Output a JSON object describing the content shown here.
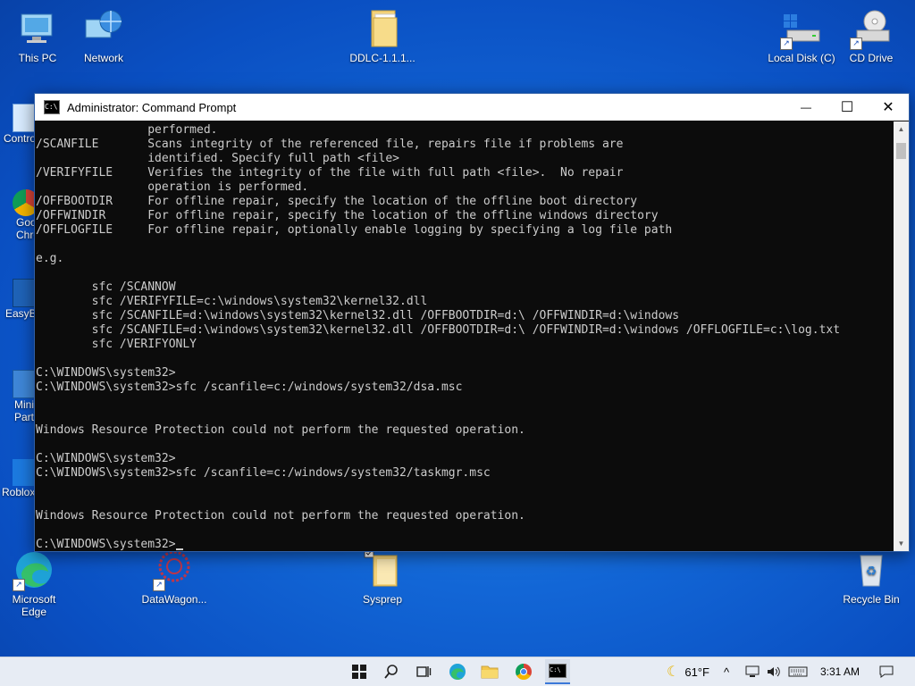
{
  "desktop": {
    "icons_top": [
      {
        "label": "This PC"
      },
      {
        "label": "Network"
      },
      {
        "label": "DDLC-1.1.1..."
      },
      {
        "label": "Local Disk (C)"
      },
      {
        "label": "CD Drive"
      }
    ],
    "icons_left_partial": [
      {
        "label": "Contro"
      },
      {
        "label": "Goo\nChro"
      },
      {
        "label": "EasyBo"
      },
      {
        "label": "Mini\nPart"
      },
      {
        "label": "Roblox"
      }
    ],
    "icons_bottom": [
      {
        "label": "Microsoft\nEdge"
      },
      {
        "label": "DataWagon..."
      },
      {
        "label": "Sysprep"
      },
      {
        "label": "Recycle Bin"
      }
    ]
  },
  "window": {
    "title": "Administrator: Command Prompt",
    "icon_text": "C:\\",
    "minimize": "—",
    "maximize": "☐",
    "close": "✕"
  },
  "console": {
    "lines": [
      "                performed.",
      "/SCANFILE       Scans integrity of the referenced file, repairs file if problems are",
      "                identified. Specify full path <file>",
      "/VERIFYFILE     Verifies the integrity of the file with full path <file>.  No repair",
      "                operation is performed.",
      "/OFFBOOTDIR     For offline repair, specify the location of the offline boot directory",
      "/OFFWINDIR      For offline repair, specify the location of the offline windows directory",
      "/OFFLOGFILE     For offline repair, optionally enable logging by specifying a log file path",
      "",
      "e.g.",
      "",
      "        sfc /SCANNOW",
      "        sfc /VERIFYFILE=c:\\windows\\system32\\kernel32.dll",
      "        sfc /SCANFILE=d:\\windows\\system32\\kernel32.dll /OFFBOOTDIR=d:\\ /OFFWINDIR=d:\\windows",
      "        sfc /SCANFILE=d:\\windows\\system32\\kernel32.dll /OFFBOOTDIR=d:\\ /OFFWINDIR=d:\\windows /OFFLOGFILE=c:\\log.txt",
      "        sfc /VERIFYONLY",
      "",
      "C:\\WINDOWS\\system32>",
      "C:\\WINDOWS\\system32>sfc /scanfile=c:/windows/system32/dsa.msc",
      "",
      "",
      "Windows Resource Protection could not perform the requested operation.",
      "",
      "C:\\WINDOWS\\system32>",
      "C:\\WINDOWS\\system32>sfc /scanfile=c:/windows/system32/taskmgr.msc",
      "",
      "",
      "Windows Resource Protection could not perform the requested operation.",
      ""
    ],
    "prompt": "C:\\WINDOWS\\system32>"
  },
  "taskbar": {
    "temperature": "61°F",
    "time": "3:31 AM"
  },
  "colors": {
    "accent": "#0a5ad0",
    "console_bg": "#0c0c0c",
    "console_fg": "#cccccc"
  }
}
